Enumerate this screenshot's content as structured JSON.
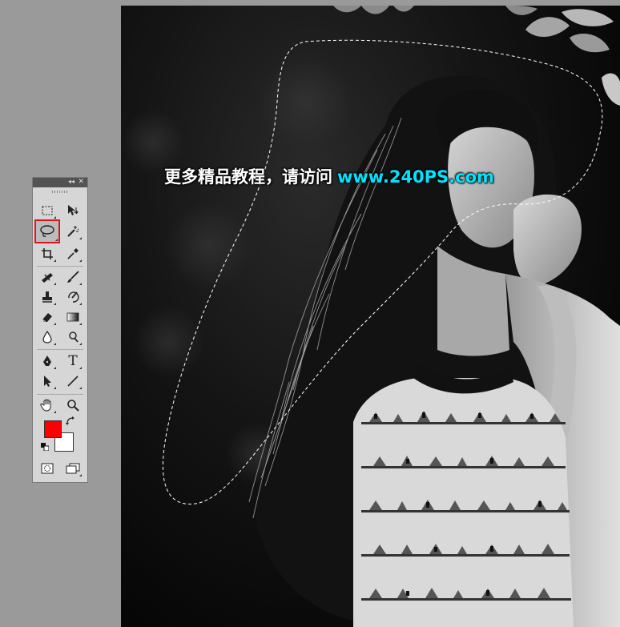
{
  "watermark": {
    "chinese_text": "更多精品教程，请访问",
    "url_text": "www.240PS.com",
    "url_color": "#00e5ff"
  },
  "toolbox": {
    "collapse_glyph": "◂◂",
    "close_glyph": "✕",
    "tools": [
      {
        "name": "rectangular-marquee-icon",
        "selected": false
      },
      {
        "name": "move-tool-icon",
        "selected": false
      },
      {
        "name": "lasso-tool-icon",
        "selected": true,
        "highlight_color": "#e0151b"
      },
      {
        "name": "magic-wand-icon",
        "selected": false
      },
      {
        "name": "crop-tool-icon",
        "selected": false
      },
      {
        "name": "eyedropper-icon",
        "selected": false
      },
      {
        "name": "healing-brush-icon",
        "selected": false
      },
      {
        "name": "brush-tool-icon",
        "selected": false
      },
      {
        "name": "clone-stamp-icon",
        "selected": false
      },
      {
        "name": "history-brush-icon",
        "selected": false
      },
      {
        "name": "eraser-icon",
        "selected": false
      },
      {
        "name": "gradient-tool-icon",
        "selected": false
      },
      {
        "name": "blur-tool-icon",
        "selected": false
      },
      {
        "name": "dodge-tool-icon",
        "selected": false
      },
      {
        "name": "pen-tool-icon",
        "selected": false
      },
      {
        "name": "type-tool-icon",
        "selected": false
      },
      {
        "name": "path-selection-icon",
        "selected": false
      },
      {
        "name": "line-tool-icon",
        "selected": false
      },
      {
        "name": "hand-tool-icon",
        "selected": false
      },
      {
        "name": "zoom-tool-icon",
        "selected": false
      }
    ],
    "type_tool_glyph": "T",
    "foreground_color": "#ff0000",
    "background_color": "#ffffff"
  }
}
